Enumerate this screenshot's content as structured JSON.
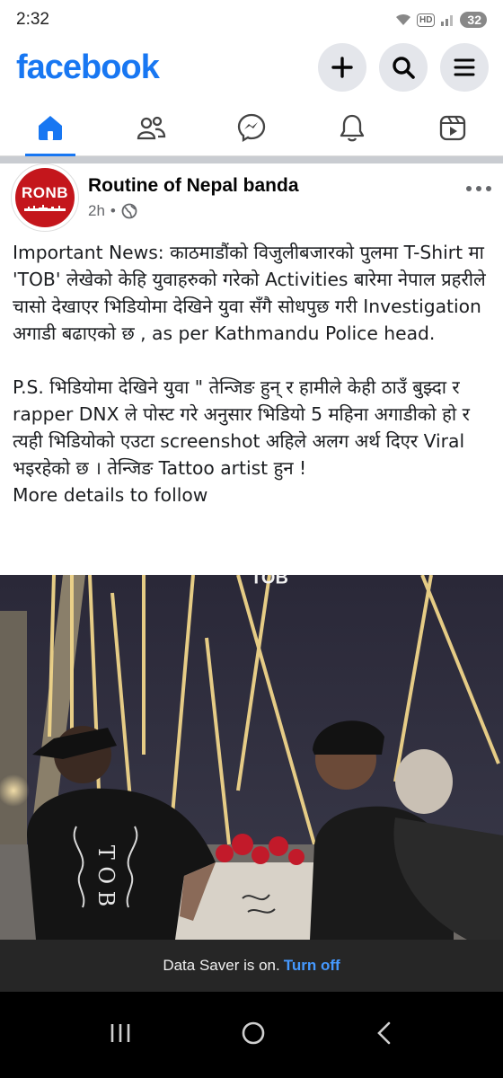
{
  "status_bar": {
    "time": "2:32",
    "hd_label": "HD",
    "battery": "32"
  },
  "header": {
    "logo": "facebook",
    "actions": [
      {
        "name": "create",
        "icon": "plus-icon"
      },
      {
        "name": "search",
        "icon": "search-icon"
      },
      {
        "name": "menu",
        "icon": "menu-icon"
      }
    ]
  },
  "nav": {
    "tabs": [
      {
        "name": "home",
        "icon": "home-icon",
        "active": true
      },
      {
        "name": "friends",
        "icon": "friends-icon",
        "active": false
      },
      {
        "name": "messenger",
        "icon": "messenger-icon",
        "active": false
      },
      {
        "name": "notifications",
        "icon": "bell-icon",
        "active": false
      },
      {
        "name": "video",
        "icon": "video-icon",
        "active": false
      }
    ]
  },
  "post": {
    "avatar_text": "RONB",
    "page_name": "Routine of Nepal banda",
    "time": "2h",
    "separator": "•",
    "privacy_icon": "globe-icon",
    "paragraph1": "Important News: काठमाडौंको विजुलीबजारको पुलमा T-Shirt मा 'TOB' लेखेको केहि युवाहरुको गरेको Activities बारेमा नेपाल प्रहरीले चासो देखाएर भिडियोमा देखिने युवा सँगै सोधपुछ गरी Investigation अगाडी बढाएको छ , as per Kathmandu Police head.",
    "paragraph2": "P.S. भिडियोमा देखिने युवा \" तेन्जिङ हुन् र हामीले केही ठाउँ बुझ्दा र rapper DNX ले पोस्ट गरे अनुसार भिडियो 5 महिना अगाडीको हो र त्यही भिडियोको एउटा screenshot अहिले अलग अर्थ दिएर Viral भइरहेको छ । तेन्जिङ Tattoo artist हुन !",
    "paragraph3": "More details to follow",
    "media_caption_overlay": "TOB",
    "shirt_text": "T O B"
  },
  "data_saver": {
    "message": "Data Saver is on.",
    "action": "Turn off"
  },
  "colors": {
    "brand": "#1877f2",
    "ronb_red": "#c4161c",
    "link_blue": "#4599ff"
  }
}
